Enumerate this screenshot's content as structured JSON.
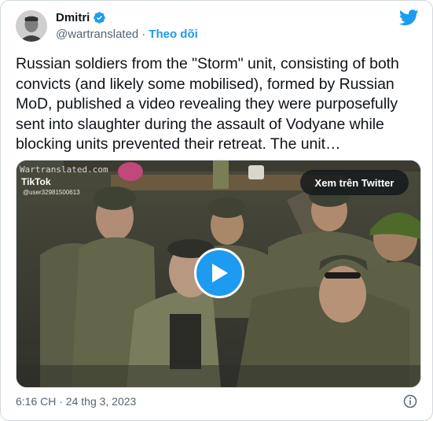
{
  "author": {
    "name": "Dmitri",
    "handle": "@wartranslated",
    "separator": "·",
    "follow_label": "Theo dõi",
    "avatar_icon": "profile-avatar",
    "verified_icon": "verified-badge-icon"
  },
  "brand": {
    "icon": "twitter-bird-icon",
    "color": "#1d9bf0"
  },
  "tweet": {
    "text": "Russian soldiers from the \"Storm\" unit, consisting of both convicts (and likely some mobilised), formed by Russian MoD, published a video revealing they were purposefully sent into slaughter during the assault of Vodyane while blocking units prevented their retreat. The unit…"
  },
  "media": {
    "watermark": "Wartranslated.com",
    "tiktok_label": "TikTok",
    "tiktok_user": "@user32981500613",
    "view_on_twitter_label": "Xem trên Twitter",
    "play_icon": "play-icon"
  },
  "footer": {
    "timestamp": "6:16 CH · 24 thg 3, 2023",
    "info_icon": "info-icon"
  },
  "colors": {
    "text_primary": "#0f1419",
    "text_secondary": "#536471",
    "border": "#cfd9de",
    "accent": "#1d9bf0"
  }
}
